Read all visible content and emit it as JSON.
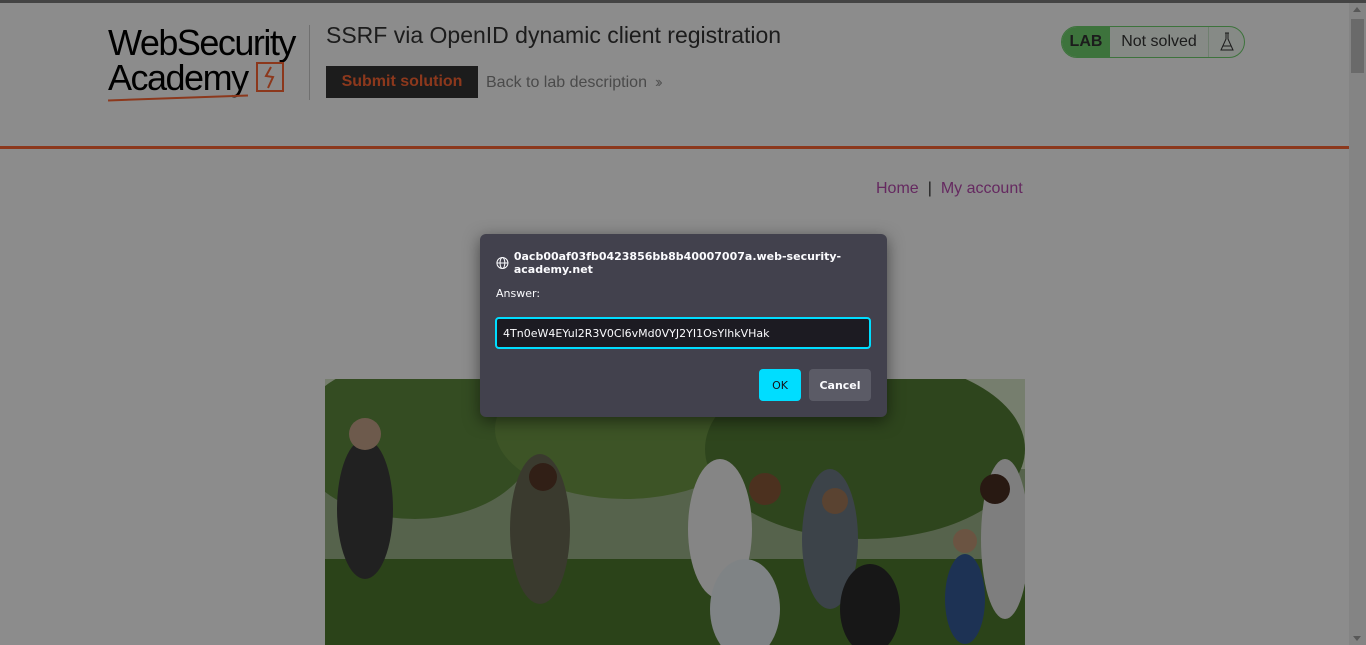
{
  "header": {
    "logo_line1": "WebSecurity",
    "logo_line2": "Academy",
    "lab_title": "SSRF via OpenID dynamic client registration",
    "submit_label": "Submit solution",
    "back_label": "Back to lab description",
    "status_badge": "LAB",
    "status_text": "Not solved"
  },
  "nav": {
    "home": "Home",
    "separator": "|",
    "my_account": "My account"
  },
  "dialog": {
    "host": "0acb00af03fb0423856bb8b40007007a.web-security-academy.net",
    "label": "Answer:",
    "input_value": "4Tn0eW4EYul2R3V0Cl6vMd0VYJ2YI1OsYlhkVHak",
    "ok_label": "OK",
    "cancel_label": "Cancel"
  },
  "colors": {
    "accent": "#ff6633",
    "status_green": "#70d16d",
    "dialog_bg": "#42414d",
    "focus": "#00ddff",
    "link": "#b84cb0"
  }
}
